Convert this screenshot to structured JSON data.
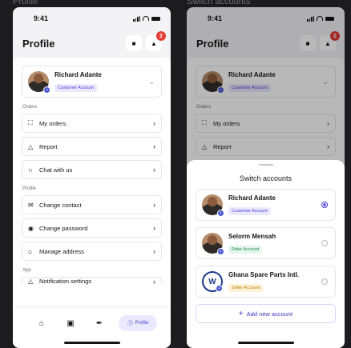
{
  "frames": {
    "left_label": "Profile",
    "right_label": "Switch accounts"
  },
  "status": {
    "time": "9:41"
  },
  "header": {
    "title": "Profile",
    "notification_count": "2"
  },
  "current_account": {
    "name": "Richard Adante",
    "role": "Customer Account"
  },
  "sections": {
    "orders": "Orders",
    "profile": "Profile",
    "app": "App"
  },
  "menu": {
    "orders": [
      {
        "label": "My orders",
        "icon": "truck-icon"
      },
      {
        "label": "Report",
        "icon": "warning-icon"
      },
      {
        "label": "Chat with us",
        "icon": "headset-icon"
      }
    ],
    "profile": [
      {
        "label": "Change contact",
        "icon": "mail-icon"
      },
      {
        "label": "Change password",
        "icon": "eye-icon"
      },
      {
        "label": "Manage address",
        "icon": "home-icon"
      }
    ],
    "app": [
      {
        "label": "Notification settings",
        "icon": "bell-icon"
      }
    ]
  },
  "tabbar": {
    "active_label": "Profile"
  },
  "switch_sheet": {
    "title": "Switch accounts",
    "accounts": [
      {
        "name": "Richard Adante",
        "role": "Customer Account",
        "selected": true
      },
      {
        "name": "Selorm Mensah",
        "role": "Rider Account",
        "selected": false
      },
      {
        "name": "Ghana Spare Parts Intl.",
        "role": "Seller Account",
        "selected": false
      }
    ],
    "add_label": "Add new account"
  },
  "colors": {
    "accent": "#4b3fd1",
    "badge": "#e53935",
    "customer_tag": "#ebe9ff",
    "rider_tag": "#e5f6ec",
    "seller_tag": "#fff3d6"
  }
}
